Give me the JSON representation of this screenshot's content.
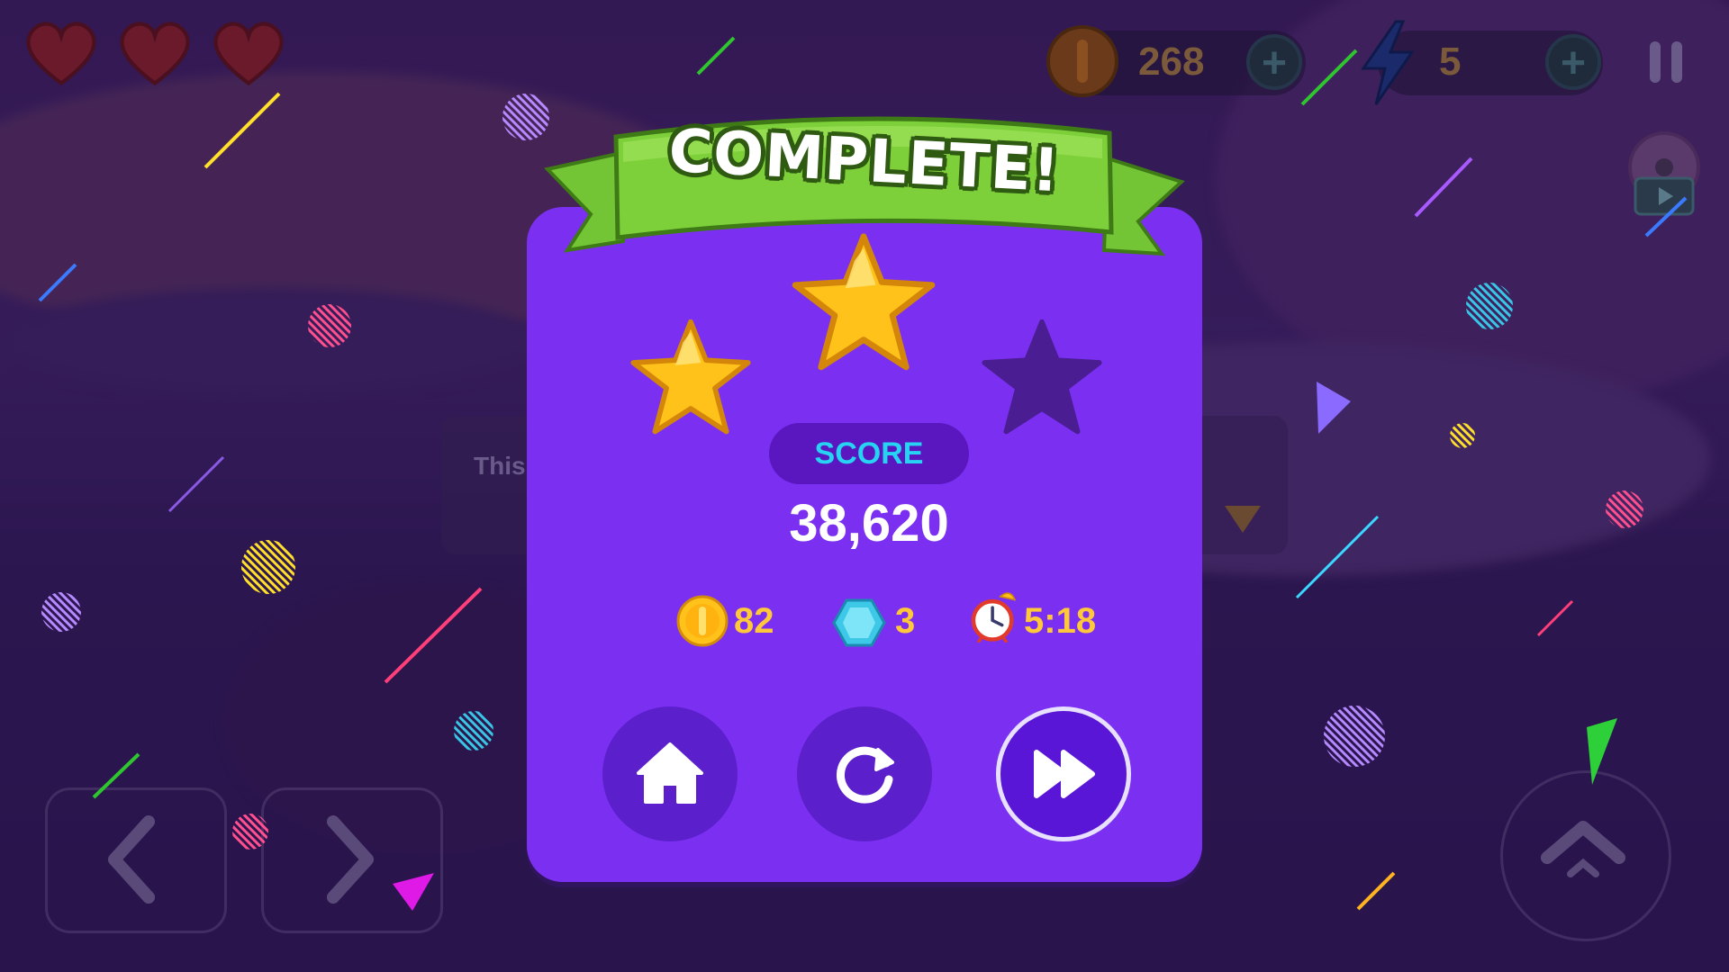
{
  "banner": {
    "title": "COMPLETE!"
  },
  "stars": {
    "earned": 2,
    "total": 3
  },
  "score": {
    "label": "SCORE",
    "value": "38,620"
  },
  "rewards": {
    "coins": "82",
    "gems": "3",
    "time": "5:18"
  },
  "hud": {
    "lives": 3,
    "coin_total": "268",
    "energy_total": "5"
  },
  "background_dialog": {
    "text_fragment": "This"
  },
  "buttons": {
    "home": "home",
    "replay": "replay",
    "next": "next-level"
  },
  "colors": {
    "panel": "#7b30f1",
    "ribbon": "#7ed03a",
    "score_label": "#27d3f2",
    "reward_text": "#ffc83a",
    "star_gold": "#ffc21a",
    "star_empty": "#4a1d93"
  }
}
